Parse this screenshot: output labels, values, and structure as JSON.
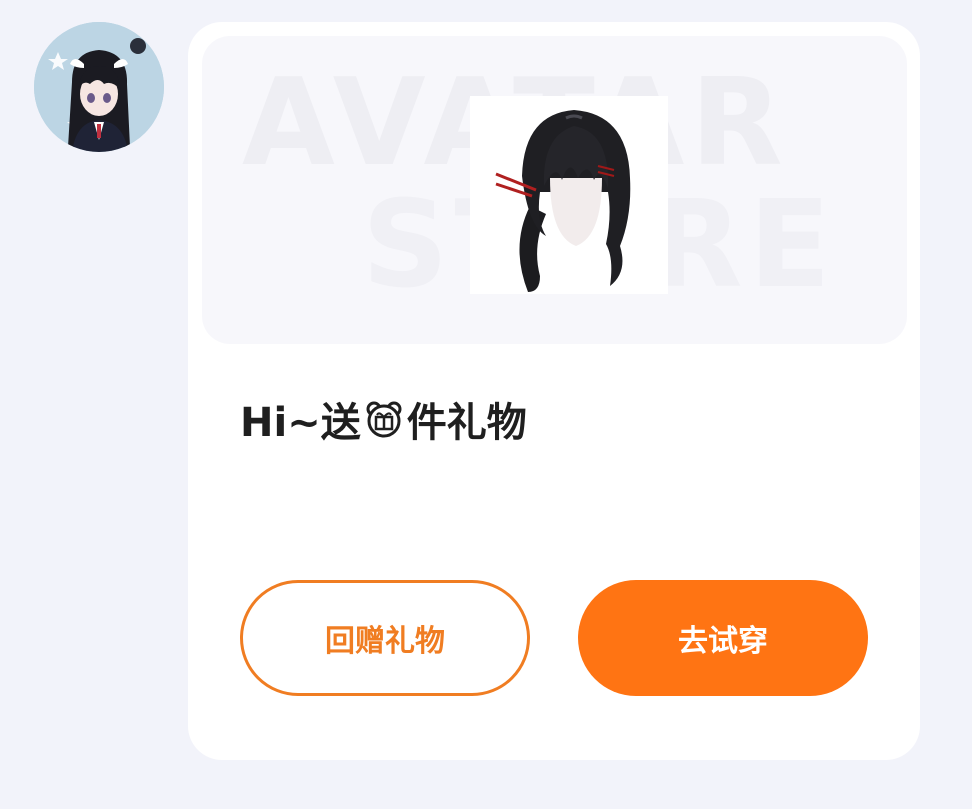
{
  "sender": {
    "avatar_icon": "anime-girl-avatar-icon"
  },
  "card": {
    "banner": {
      "watermark_line1": "AVATAR",
      "watermark_line2": "STORE",
      "product_icon": "black-hairstyle-icon"
    },
    "message": {
      "prefix": "Hi~送",
      "emoji_icon": "gift-bear-emoji-icon",
      "suffix": "件礼物"
    },
    "buttons": {
      "return_gift_label": "回赠礼物",
      "try_on_label": "去试穿"
    }
  },
  "colors": {
    "accent": "#ff7413",
    "accent_border": "#f07d22",
    "page_bg": "#f2f3fa",
    "card_bg": "#ffffff"
  }
}
